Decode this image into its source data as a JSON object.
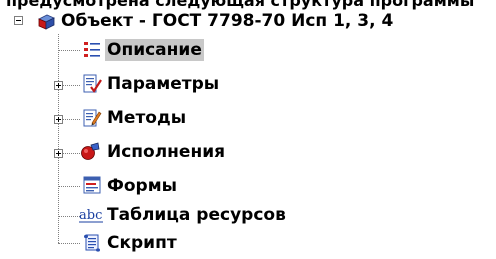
{
  "header_fragment": "предусмотрена следующая структура программы",
  "tree": {
    "root": {
      "label": "Объект - ГОСТ 7798-70 Исп 1, 3, 4",
      "expander": "minus",
      "icon": "object-cube-icon"
    },
    "children": [
      {
        "label": "Описание",
        "icon": "description-list-icon",
        "expander": null,
        "selected": true
      },
      {
        "label": "Параметры",
        "icon": "parameters-check-icon",
        "expander": "plus",
        "selected": false
      },
      {
        "label": "Методы",
        "icon": "methods-edit-icon",
        "expander": "plus",
        "selected": false
      },
      {
        "label": "Исполнения",
        "icon": "executions-sphere-icon",
        "expander": "plus",
        "selected": false
      },
      {
        "label": "Формы",
        "icon": "forms-window-icon",
        "expander": null,
        "selected": false
      },
      {
        "label": "Таблица ресурсов",
        "icon": "resource-table-abc-icon",
        "expander": null,
        "selected": false
      },
      {
        "label": "Скрипт",
        "icon": "script-scroll-icon",
        "expander": null,
        "selected": false
      }
    ]
  }
}
